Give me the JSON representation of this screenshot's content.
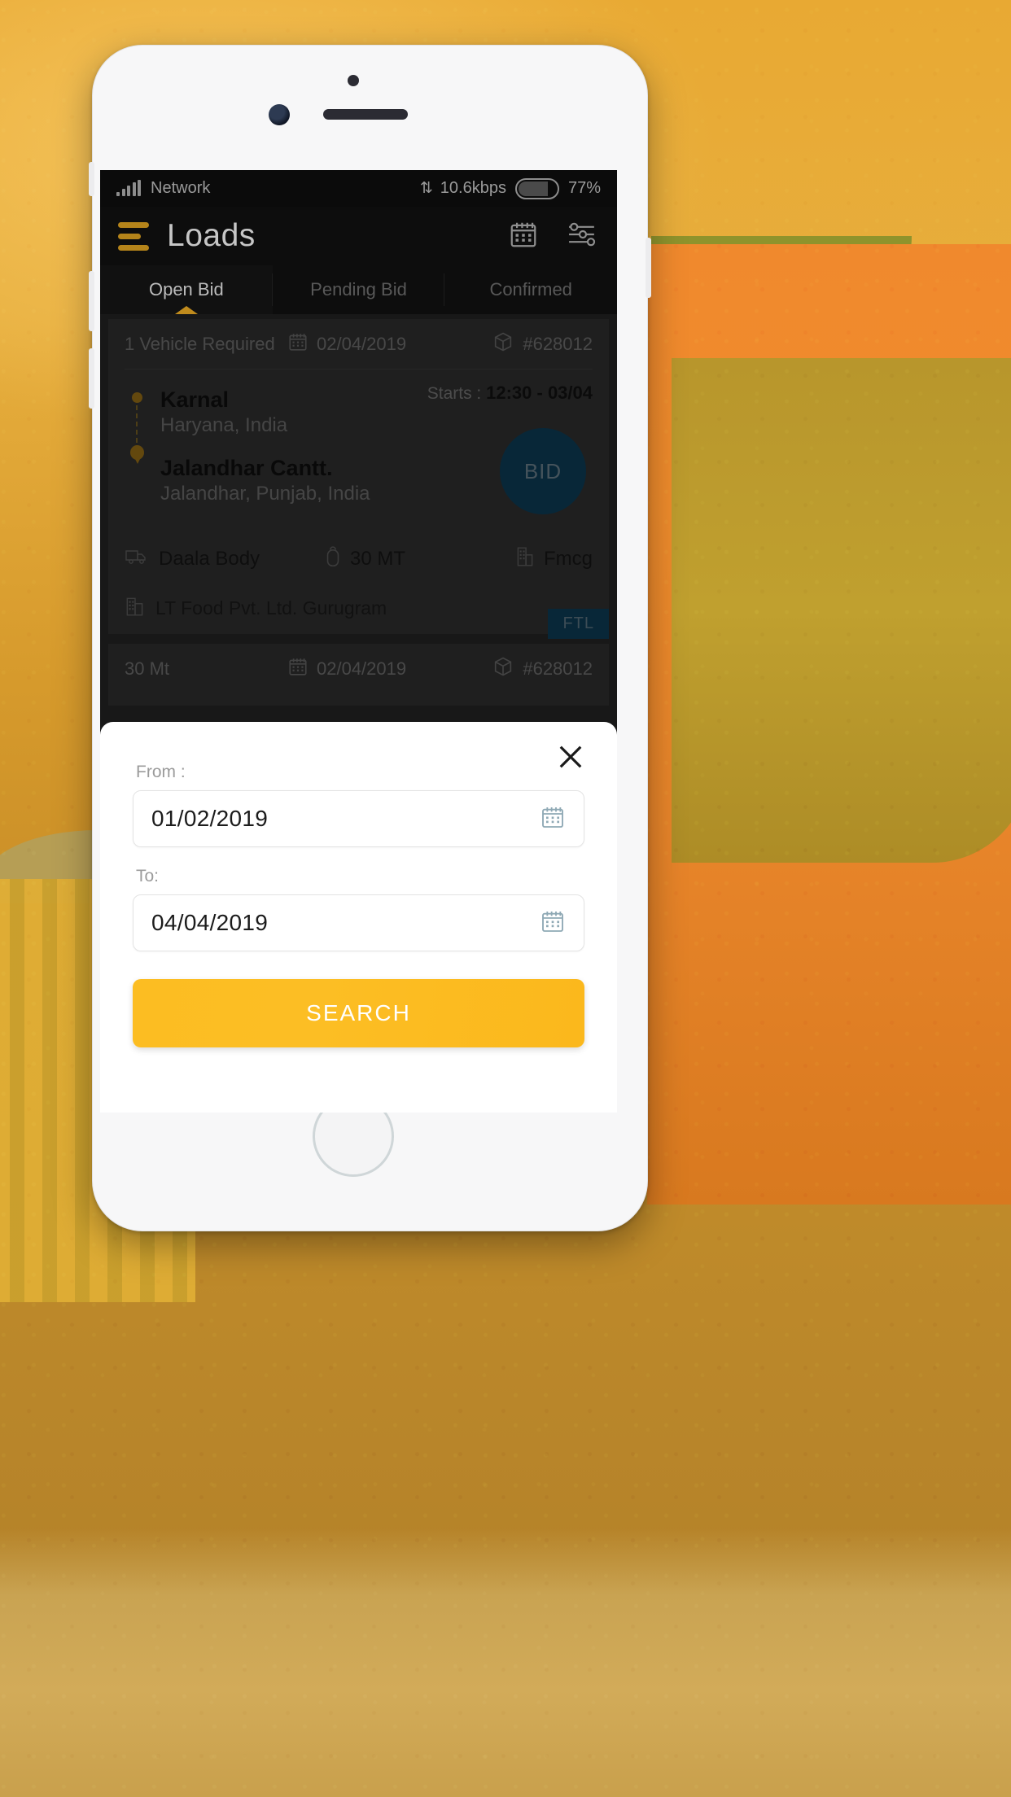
{
  "status_bar": {
    "carrier": "Network",
    "data_rate": "10.6kbps",
    "data_arrows": "⇅",
    "battery_percent": "77%"
  },
  "app_bar": {
    "title": "Loads",
    "menu_icon": "hamburger-icon",
    "calendar_icon": "calendar-icon",
    "filter_icon": "filter-sliders-icon"
  },
  "tabs": [
    {
      "label": "Open Bid",
      "active": true
    },
    {
      "label": "Pending Bid",
      "active": false
    },
    {
      "label": "Confirmed",
      "active": false
    }
  ],
  "loads": [
    {
      "vehicle_requirement": "1 Vehicle Required",
      "date": "02/04/2019",
      "load_id": "#628012",
      "origin_city": "Karnal",
      "origin_state": "Haryana, India",
      "destination_city": "Jalandhar Cantt.",
      "destination_state": "Jalandhar, Punjab, India",
      "starts_label": "Starts :",
      "starts_value": "12:30 - 03/04",
      "bid_label": "BID",
      "body_type": "Daala Body",
      "weight": "30 MT",
      "goods_type": "Fmcg",
      "shipper": "LT Food Pvt. Ltd. Gurugram",
      "load_type_badge": "FTL"
    },
    {
      "vehicle_requirement": "30 Mt",
      "date": "02/04/2019",
      "load_id": "#628012"
    }
  ],
  "modal": {
    "close_icon": "close-icon",
    "from_label": "From :",
    "from_value": "01/02/2019",
    "from_placeholder": "DD/MM/YYYY",
    "to_label": "To:",
    "to_value": "04/04/2019",
    "to_placeholder": "DD/MM/YYYY",
    "search_label": "SEARCH",
    "calendar_icon": "calendar-icon"
  },
  "colors": {
    "accent_gold": "#FCBD22",
    "brand_amber": "#B5841A",
    "bid_blue": "#0F4767",
    "app_dark": "#0D0D0D",
    "card_gray": "#3A3A3A"
  }
}
